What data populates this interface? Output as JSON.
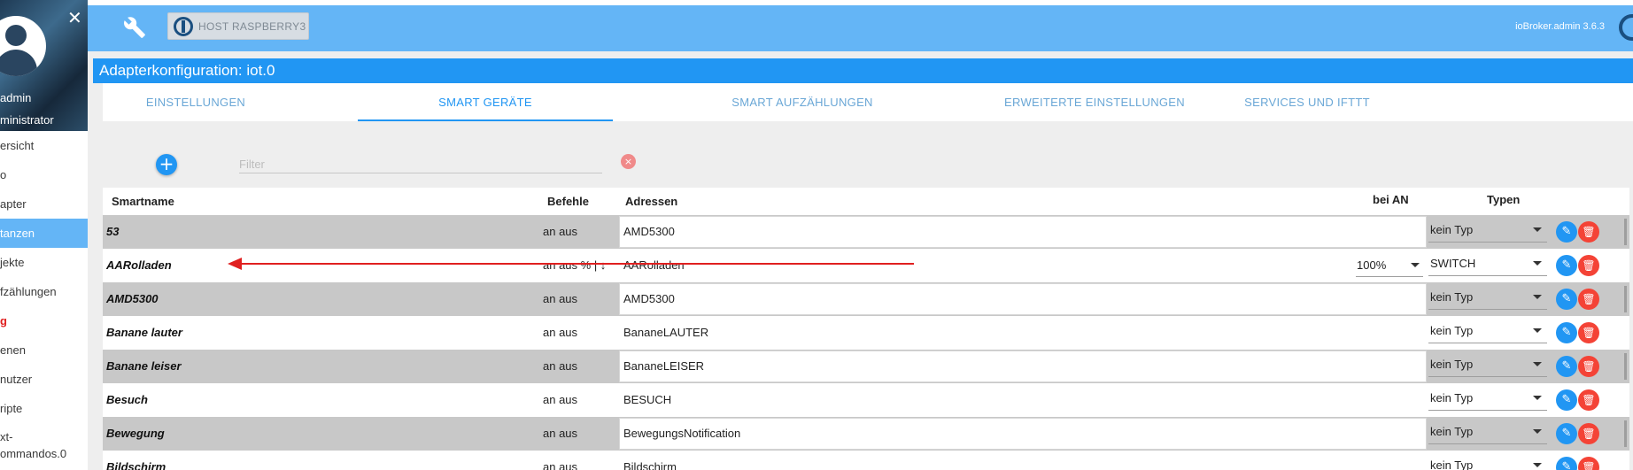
{
  "sidebar": {
    "close": "✕",
    "user": "admin",
    "role": "ministrator",
    "items": [
      {
        "label": "ersicht"
      },
      {
        "label": "o"
      },
      {
        "label": "apter"
      },
      {
        "label": "tanzen",
        "active": true
      },
      {
        "label": "jekte"
      },
      {
        "label": "fzählungen"
      },
      {
        "label": "g",
        "red": true
      },
      {
        "label": "enen"
      },
      {
        "label": "nutzer"
      },
      {
        "label": "ripte"
      },
      {
        "label": "xt-\nommandos.0"
      }
    ]
  },
  "topbar": {
    "host_label": "HOST RASPBERRY3",
    "version": "ioBroker.admin 3.6.3"
  },
  "page": {
    "title": "Adapterkonfiguration: iot.0"
  },
  "tabs": [
    {
      "label": "EINSTELLUNGEN"
    },
    {
      "label": "SMART GERÄTE",
      "active": true
    },
    {
      "label": "SMART AUFZÄHLUNGEN"
    },
    {
      "label": "ERWEITERTE EINSTELLUNGEN"
    },
    {
      "label": "SERVICES UND IFTTT"
    }
  ],
  "toolbar": {
    "add_label": "+",
    "filter_placeholder": "Filter",
    "filter_value": "",
    "clear_label": "×"
  },
  "table": {
    "headers": {
      "smartname": "Smartname",
      "befehle": "Befehle",
      "adressen": "Adressen",
      "bei_an": "bei AN",
      "typen": "Typen"
    },
    "rows": [
      {
        "name": "53",
        "cmds": "an aus",
        "addr": "AMD5300",
        "on": "",
        "type": "kein Typ",
        "shade": "gray"
      },
      {
        "name": "AARolladen",
        "cmds": "an aus % | ↓",
        "addr": "AARolladen",
        "on": "100%",
        "type": "SWITCH",
        "shade": "white"
      },
      {
        "name": "AMD5300",
        "cmds": "an aus",
        "addr": "AMD5300",
        "on": "",
        "type": "kein Typ",
        "shade": "gray"
      },
      {
        "name": "Banane lauter",
        "cmds": "an aus",
        "addr": "BananeLAUTER",
        "on": "",
        "type": "kein Typ",
        "shade": "white"
      },
      {
        "name": "Banane leiser",
        "cmds": "an aus",
        "addr": "BananeLEISER",
        "on": "",
        "type": "kein Typ",
        "shade": "gray"
      },
      {
        "name": "Besuch",
        "cmds": "an aus",
        "addr": "BESUCH",
        "on": "",
        "type": "kein Typ",
        "shade": "white"
      },
      {
        "name": "Bewegung",
        "cmds": "an aus",
        "addr": "BewegungsNotification",
        "on": "",
        "type": "kein Typ",
        "shade": "gray"
      },
      {
        "name": "Bildschirm",
        "cmds": "an aus",
        "addr": "Bildschirm",
        "on": "",
        "type": "kein Typ",
        "shade": "white"
      }
    ],
    "row_actions": {
      "edit": "✎",
      "delete": "🗑"
    }
  },
  "colors": {
    "topbar": "#64b5f6",
    "title": "#2196f3",
    "row_gray": "#c8c8c8",
    "accent": "#2196f3",
    "danger": "#f44336",
    "annotation_arrow": "#e02020"
  }
}
